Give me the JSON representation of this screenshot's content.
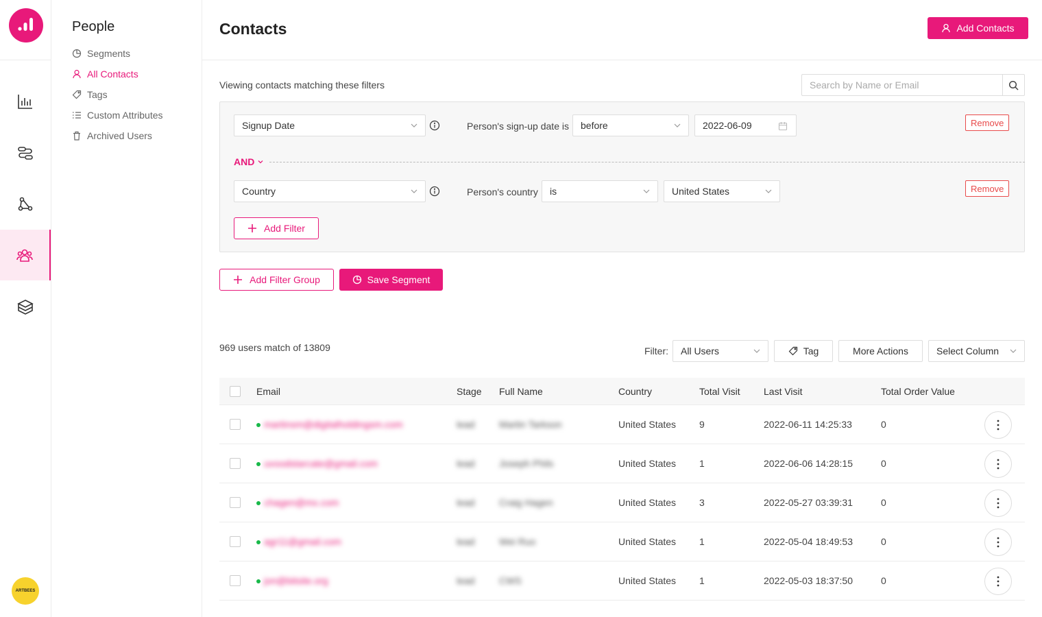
{
  "avatar": {
    "text": "ARTBEES"
  },
  "subnav": {
    "title": "People",
    "items": [
      {
        "label": "Segments",
        "icon": "pie-chart-icon"
      },
      {
        "label": "All Contacts",
        "icon": "user-icon"
      },
      {
        "label": "Tags",
        "icon": "tag-icon"
      },
      {
        "label": "Custom Attributes",
        "icon": "list-icon"
      },
      {
        "label": "Archived Users",
        "icon": "trash-icon"
      }
    ]
  },
  "header": {
    "title": "Contacts",
    "add_contacts_label": "Add Contacts"
  },
  "filters": {
    "viewing_text": "Viewing contacts matching these filters",
    "search_placeholder": "Search by Name or Email",
    "rule1": {
      "field": "Signup Date",
      "label": "Person's sign-up date is",
      "operator": "before",
      "value": "2022-06-09",
      "remove_label": "Remove"
    },
    "and_label": "AND",
    "rule2": {
      "field": "Country",
      "label": "Person's country",
      "operator": "is",
      "value": "United States",
      "remove_label": "Remove"
    },
    "add_filter_label": "Add Filter",
    "add_filter_group_label": "Add Filter Group",
    "save_segment_label": "Save Segment"
  },
  "results": {
    "count_text": "969 users match of 13809",
    "filter_label": "Filter:",
    "filter_value": "All Users",
    "tag_label": "Tag",
    "more_actions_label": "More Actions",
    "select_column_label": "Select Column"
  },
  "table": {
    "columns": [
      "Email",
      "Stage",
      "Full Name",
      "Country",
      "Total Visit",
      "Last Visit",
      "Total Order Value"
    ],
    "rows": [
      {
        "email": "martinsm@digitalholdingsm.com",
        "stage": "lead",
        "name": "Martin Tarkson",
        "country": "United States",
        "visits": "9",
        "last_visit": "2022-06-11 14:25:33",
        "order_value": "0"
      },
      {
        "email": "uvoodstarcate@gmail.com",
        "stage": "lead",
        "name": "Joseph Phils",
        "country": "United States",
        "visits": "1",
        "last_visit": "2022-06-06 14:28:15",
        "order_value": "0"
      },
      {
        "email": "chagen@mx.com",
        "stage": "lead",
        "name": "Craig Hagen",
        "country": "United States",
        "visits": "3",
        "last_visit": "2022-05-27 03:39:31",
        "order_value": "0"
      },
      {
        "email": "agr11@gmail.com",
        "stage": "lead",
        "name": "Wei Ruo",
        "country": "United States",
        "visits": "1",
        "last_visit": "2022-05-04 18:49:53",
        "order_value": "0"
      },
      {
        "email": "jon@bitsite.org",
        "stage": "lead",
        "name": "CWS",
        "country": "United States",
        "visits": "1",
        "last_visit": "2022-05-03 18:37:50",
        "order_value": "0"
      }
    ]
  },
  "colors": {
    "accent": "#e8197a",
    "danger": "#e84a4a",
    "online": "#19b94a",
    "avatar_bg": "#f7d22d"
  }
}
